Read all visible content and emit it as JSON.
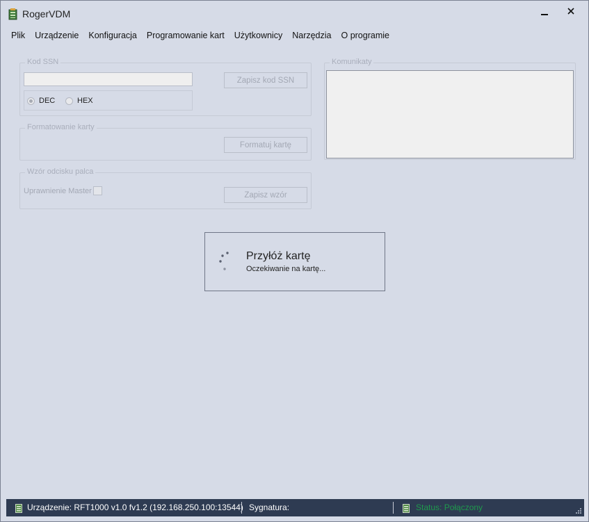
{
  "window": {
    "title": "RogerVDM",
    "icons": {
      "app": "device-battery-icon",
      "minimize": "minimize-icon",
      "close": "close-icon"
    }
  },
  "menu": {
    "items": [
      {
        "label": "Plik"
      },
      {
        "label": "Urządzenie"
      },
      {
        "label": "Konfiguracja"
      },
      {
        "label": "Programowanie kart"
      },
      {
        "label": "Użytkownicy"
      },
      {
        "label": "Narzędzia"
      },
      {
        "label": "O programie"
      }
    ]
  },
  "ssn": {
    "legend": "Kod SSN",
    "input_value": "",
    "dec_label": "DEC",
    "hex_label": "HEX",
    "selected": "DEC",
    "save_label": "Zapisz kod SSN"
  },
  "format": {
    "legend": "Formatowanie karty",
    "button_label": "Formatuj kartę"
  },
  "fingerprint": {
    "legend": "Wzór odcisku palca",
    "master_label": "Uprawnienie Master",
    "master_checked": false,
    "save_label": "Zapisz wzór"
  },
  "messages": {
    "legend": "Komunikaty",
    "content": ""
  },
  "wait": {
    "title": "Przyłóż kartę",
    "subtitle": "Oczekiwanie na kartę..."
  },
  "statusbar": {
    "device": "Urządzenie: RFT1000 v1.0 fv1.2 (192.168.250.100:13544)",
    "signature": "Sygnatura:",
    "status": "Status: Połączony"
  },
  "colors": {
    "background": "#d6dbe7",
    "statusbar": "#2e3b52",
    "status_ok": "#1f9a4d"
  }
}
